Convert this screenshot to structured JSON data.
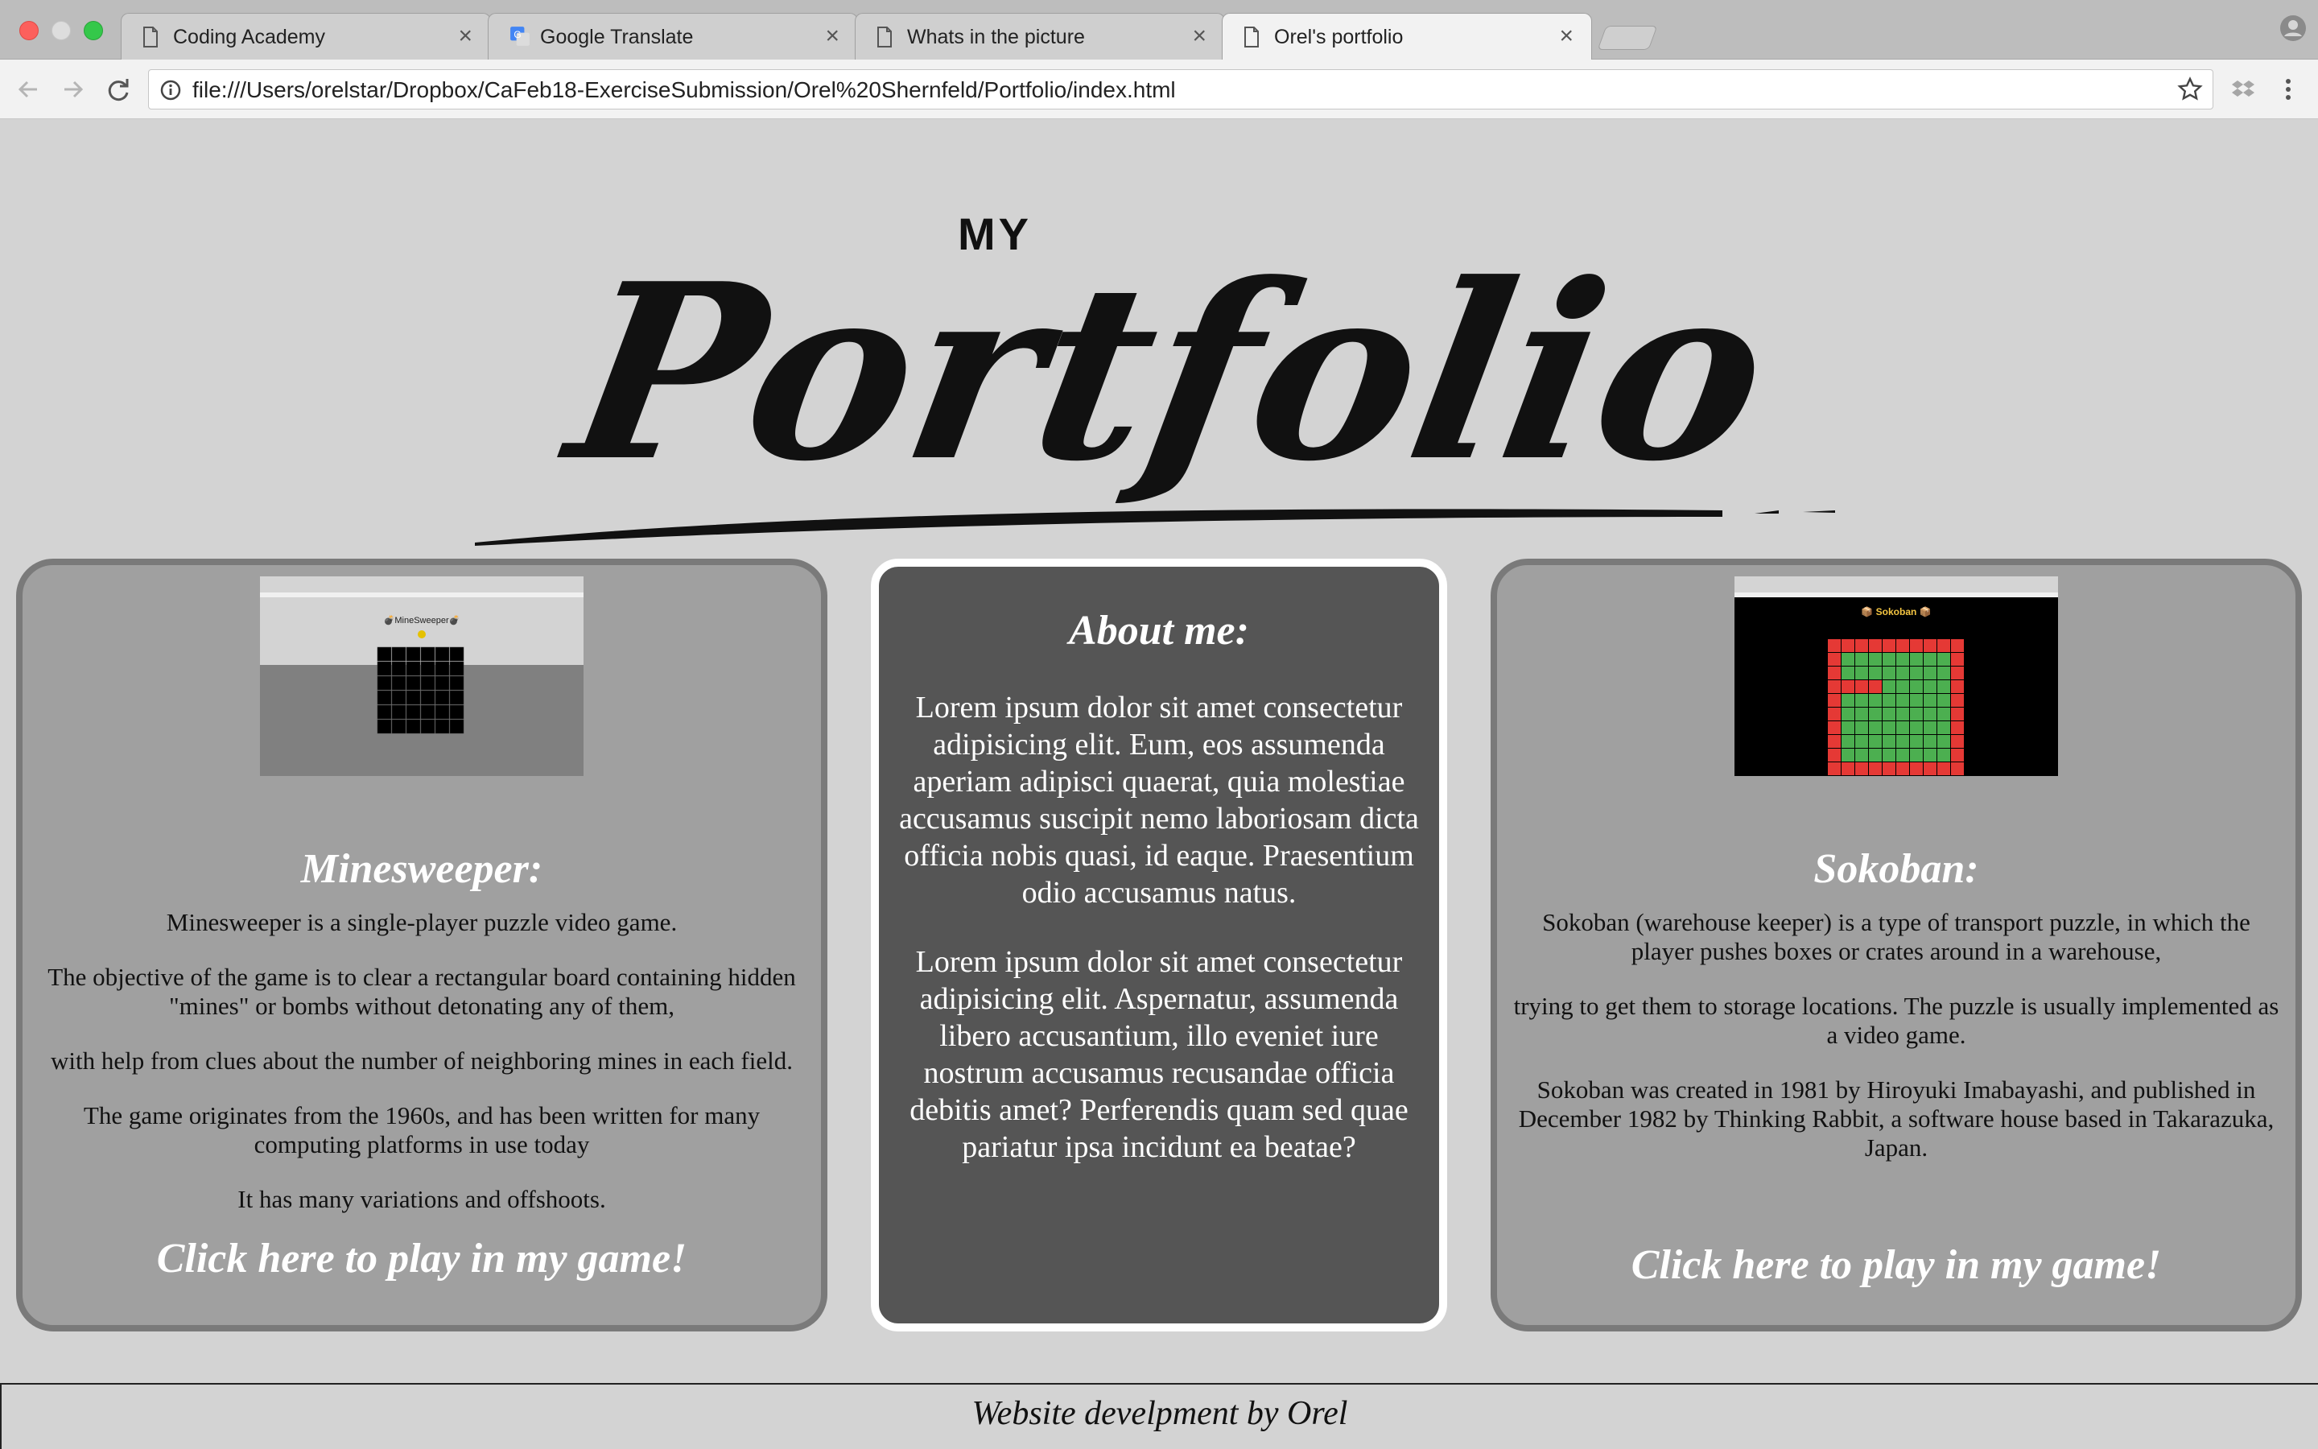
{
  "browser": {
    "tabs": [
      {
        "label": "Coding Academy",
        "icon": "page-icon"
      },
      {
        "label": "Google Translate",
        "icon": "google-translate-icon"
      },
      {
        "label": "Whats in the picture",
        "icon": "page-icon"
      },
      {
        "label": "Orel's portfolio",
        "icon": "page-icon",
        "active": true
      }
    ],
    "url": "file:///Users/orelstar/Dropbox/CaFeb18-ExerciseSubmission/Orel%20Shernfeld/Portfolio/index.html"
  },
  "header": {
    "logo_small": "MY",
    "logo_script": "Portfolio"
  },
  "minesweeper": {
    "title": "Minesweeper:",
    "paragraphs": [
      "Minesweeper is a single-player puzzle video game.",
      "The objective of the game is to clear a rectangular board containing hidden \"mines\" or bombs without detonating any of them,",
      "with help from clues about the number of neighboring mines in each field.",
      "The game originates from the 1960s, and has been written for many computing platforms in use today",
      "It has many variations and offshoots."
    ],
    "link": "Click here to play in my game!",
    "screenshot_title": "💣MineSweeper💣"
  },
  "about": {
    "title": "About me:",
    "paragraphs": [
      "Lorem ipsum dolor sit amet consectetur adipisicing elit. Eum, eos assumenda aperiam adipisci quaerat, quia molestiae accusamus suscipit nemo laboriosam dicta officia nobis quasi, id eaque. Praesentium odio accusamus natus.",
      "Lorem ipsum dolor sit amet consectetur adipisicing elit. Aspernatur, assumenda libero accusantium, illo eveniet iure nostrum accusamus recusandae officia debitis amet? Perferendis quam sed quae pariatur ipsa incidunt ea beatae?"
    ]
  },
  "sokoban": {
    "title": "Sokoban:",
    "paragraphs": [
      "Sokoban (warehouse keeper) is a type of transport puzzle, in which the player pushes boxes or crates around in a warehouse,",
      "trying to get them to storage locations. The puzzle is usually implemented as a video game.",
      "Sokoban was created in 1981 by Hiroyuki Imabayashi, and published in December 1982 by Thinking Rabbit, a software house based in Takarazuka, Japan."
    ],
    "link": "Click here to play in my game!",
    "screenshot_title": "📦 Sokoban 📦"
  },
  "footer": {
    "text": "Website develpment by Orel"
  },
  "colors": {
    "page_bg": "#d3d3d3",
    "card_bg": "#a0a0a0",
    "card_border": "#7a7a7a",
    "about_bg": "#555555",
    "sokoban_wall": "#e53935",
    "sokoban_floor": "#4caf50"
  }
}
